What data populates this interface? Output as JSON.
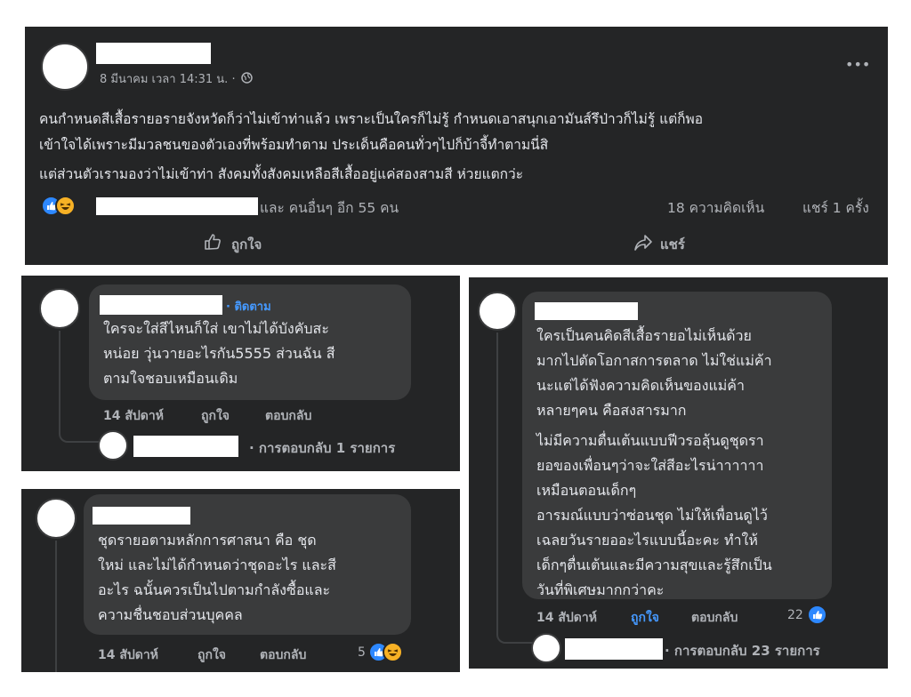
{
  "post": {
    "timestamp": "8 มีนาคม เวลา 14:31 น. · ",
    "privacy_icon": "globe-icon",
    "more_label": "•••",
    "body_line1": "คนกำหนดสีเสื้อรายอรายจังหวัดก็ว่าไม่เข้าท่าแล้ว เพราะเป็นใครก็ไม่รู้ กำหนดเอาสนุกเอามันส์รึป่าวก็ไม่รู้ แต่ก็พอ",
    "body_line2": "เข้าใจได้เพราะมีมวลชนของตัวเองที่พร้อมทำตาม ประเด็นคือคนทั่วๆไปก็บ้าจี้ทำตามนี่สิ",
    "body_line3": "แต่ส่วนตัวเรามองว่าไม่เข้าท่า สังคมทั้งสังคมเหลือสีเสื้ออยู่แค่สองสามสี ห่วยแตกว่ะ",
    "reactions_text": "และ คนอื่นๆ อีก 55 คน",
    "comments_count": "18 ความคิดเห็น",
    "shares_count": "แชร์ 1 ครั้ง",
    "like_label": "ถูกใจ",
    "share_label": "แชร์",
    "colors": {
      "panel": "#242526",
      "bubble": "#3a3b3c",
      "accent": "#4599ff",
      "like": "#2d88ff",
      "haha": "#f7b125"
    }
  },
  "comment1": {
    "follow_label": "· ติดตาม",
    "text": "ใครจะใส่สีไหนก็ใส่ เขาไม่ได้บังคับสะ\nหน่อย วุ่นวายอะไรกัน5555 ส่วนฉัน สี\nตามใจชอบเหมือนเดิม",
    "time": "14 สัปดาห์",
    "like": "ถูกใจ",
    "reply": "ตอบกลับ",
    "replies": "· การตอบกลับ 1 รายการ"
  },
  "comment2": {
    "text": "ชุดรายอตามหลักการศาสนา คือ ชุด\nใหม่ และไม่ได้กำหนดว่าชุดอะไร และสี\nอะไร ฉนั้นควรเป็นไปตามกำลังซื้อและ\nความชื่นชอบส่วนบุคคล",
    "time": "14 สัปดาห์",
    "like": "ถูกใจ",
    "reply": "ตอบกลับ",
    "reaction_count": "5"
  },
  "comment3": {
    "text_p1": "ใครเป็นคนคิดสีเสื้อรายอไม่เห็นด้วย\nมากไปตัดโอกาสการตลาด ไม่ใช่แม่ค้า\nนะแต่ได้ฟังความคิดเห็นของแม่ค้า\nหลายๆคน คือสงสารมาก",
    "text_p2": "ไม่มีความตื่นเต้นแบบฟีวรอลุ้นดูชุดรา\nยอของเพื่อนๆว่าจะใส่สีอะไรน่าาาาาา\nเหมือนตอนเด็กๆ\nอารมณ์แบบว่าซ่อนชุด ไม่ให้เพื่อนดูไว้\nเฉลยวันรายออะไรแบบนี้อะคะ ทำให้\nเด็กๆตื่นเต้นและมีความสุขและรู้สึกเป็น\nวันที่พิเศษมากกว่าคะ",
    "time": "14 สัปดาห์",
    "like": "ถูกใจ",
    "reply": "ตอบกลับ",
    "reaction_count": "22",
    "replies": "· การตอบกลับ 23 รายการ"
  }
}
